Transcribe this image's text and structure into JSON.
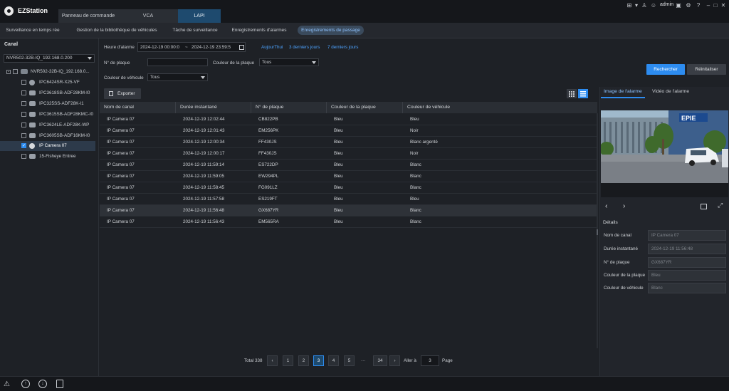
{
  "app": {
    "title": "EZStation",
    "user": "admin"
  },
  "main_tabs": [
    {
      "label": "Panneau de commande"
    },
    {
      "label": "VCA"
    },
    {
      "label": "LAPI"
    }
  ],
  "sub_tabs": [
    {
      "label": "Surveillance en temps rée"
    },
    {
      "label": "Gestion de la bibliothèque de véhicules"
    },
    {
      "label": "Tâche de surveillance"
    },
    {
      "label": "Enregistrements d'alarmes"
    },
    {
      "label": "Enregistrements de passage"
    }
  ],
  "left_panel": {
    "title": "Canal",
    "nvr_select": "NVR502-32B-IQ_192.168.0.200",
    "tree_root": "NVR502-32B-IQ_192.168.0...",
    "cameras": [
      {
        "label": "IPC6424SR-X25-VF",
        "checked": false
      },
      {
        "label": "IPC3618SB-ADF28KM-I0",
        "checked": false
      },
      {
        "label": "IPC325SS-ADF28K-I1",
        "checked": false
      },
      {
        "label": "IPC3615SB-ADF28KMC-I0",
        "checked": false
      },
      {
        "label": "IPC3624LE-ADF28K-WP",
        "checked": false
      },
      {
        "label": "IPC3605SB-ADF16KM-I0",
        "checked": false
      },
      {
        "label": "IP Camera 07",
        "checked": true
      },
      {
        "label": "15-Fisheye Entree",
        "checked": false
      }
    ]
  },
  "filters": {
    "alarm_time_label": "Heure d'alarme",
    "start_time": "2024-12-19 00:00:0",
    "separator": "~",
    "end_time": "2024-12-19 23:59:5",
    "today": "AujourThui",
    "last3": "3 derniers jours",
    "last7": "7 derniers jours",
    "plate_label": "N° de plaque",
    "plate_value": "",
    "plate_color_label": "Couleur de la plaque",
    "plate_color_value": "Tous",
    "vehicle_color_label": "Couleur de véhicule",
    "vehicle_color_value": "Tous",
    "search_label": "Rechercher",
    "reset_label": "Réinitaliser"
  },
  "toolbar": {
    "export_label": "Exporter"
  },
  "table": {
    "headers": [
      "Nom de canal",
      "Durée instantané",
      "N° de plaque",
      "Couleur de la plaque",
      "Couleur de véhicule"
    ],
    "rows": [
      [
        "IP Camera 07",
        "2024-12-19 12:02:44",
        "CB822PB",
        "Bleu",
        "Bleu"
      ],
      [
        "IP Camera 07",
        "2024-12-19 12:01:43",
        "EM256PK",
        "Bleu",
        "Noir"
      ],
      [
        "IP Camera 07",
        "2024-12-19 12:00:34",
        "FF430JS",
        "Bleu",
        "Blanc argenté"
      ],
      [
        "IP Camera 07",
        "2024-12-19 12:00:17",
        "FF430JS",
        "Bleu",
        "Noir"
      ],
      [
        "IP Camera 07",
        "2024-12-19 11:59:14",
        "ES722DP",
        "Bleu",
        "Blanc"
      ],
      [
        "IP Camera 07",
        "2024-12-19 11:59:05",
        "EW294PL",
        "Bleu",
        "Blanc"
      ],
      [
        "IP Camera 07",
        "2024-12-19 11:58:45",
        "FG091LZ",
        "Bleu",
        "Blanc"
      ],
      [
        "IP Camera 07",
        "2024-12-19 11:57:58",
        "ES219FT",
        "Bleu",
        "Bleu"
      ],
      [
        "IP Camera 07",
        "2024-12-19 11:56:48",
        "GX687YR",
        "Bleu",
        "Blanc"
      ],
      [
        "IP Camera 07",
        "2024-12-19 11:56:43",
        "EM565RA",
        "Bleu",
        "Blanc"
      ]
    ],
    "highlighted_row": 8
  },
  "pagination": {
    "total": "Total 338",
    "prev": "‹",
    "pages": [
      "1",
      "2",
      "3",
      "4",
      "5"
    ],
    "ellipsis": "···",
    "last": "34",
    "next": "›",
    "current": "3",
    "goto_label": "Aller à",
    "goto_value": "3",
    "page_label": "Page"
  },
  "right_panel": {
    "tab_image": "Image de l'alarme",
    "tab_video": "Vidéo de l'alarme",
    "photo_text": "EPIE",
    "details_title": "Détails",
    "fields": [
      {
        "label": "Nom de canal",
        "value": "IP Camera 07"
      },
      {
        "label": "Durée instantané",
        "value": "2024-12-19 11:56:48"
      },
      {
        "label": "N° de plaque",
        "value": "GX687YR"
      },
      {
        "label": "Couleur de la plaque",
        "value": "Bleu"
      },
      {
        "label": "Couleur de véhicule",
        "value": "Blanc"
      }
    ]
  },
  "colors": {
    "accent": "#2d8cf0",
    "background": "#1e2126",
    "header": "#15171b"
  }
}
